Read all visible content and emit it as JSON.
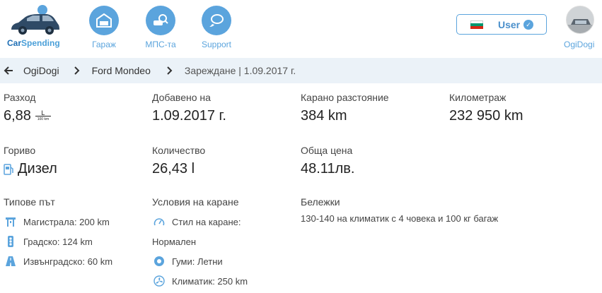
{
  "header": {
    "logo_label_car": "Car",
    "logo_label_spending": "Spending",
    "nav": [
      {
        "label": "Гараж",
        "icon": "garage-icon"
      },
      {
        "label": "МПС-та",
        "icon": "vehicle-search-icon"
      },
      {
        "label": "Support",
        "icon": "support-chat-icon"
      }
    ],
    "user_label": "User",
    "avatar_name": "OgiDogi",
    "accent": "#5ba4dd"
  },
  "breadcrumb": {
    "items": [
      "OgiDogi",
      "Ford Mondeo"
    ],
    "current": "Зареждане | 1.09.2017 г."
  },
  "details": {
    "consumption_label": "Разход",
    "consumption_value": "6,88",
    "consumption_unit_top": "L",
    "consumption_unit_bottom": "100 km",
    "added_label": "Добавено на",
    "added_value": "1.09.2017 г.",
    "distance_label": "Карано разстояние",
    "distance_value": "384 km",
    "odometer_label": "Километраж",
    "odometer_value": "232 950 km",
    "fuel_label": "Гориво",
    "fuel_value": "Дизел",
    "quantity_label": "Количество",
    "quantity_value": "26,43 l",
    "total_label": "Обща цена",
    "total_value": "48.11лв.",
    "road_label": "Типове път",
    "roads": [
      {
        "text": "Магистрала: 200 km",
        "icon": "highway-icon"
      },
      {
        "text": "Градско: 124 km",
        "icon": "traffic-light-icon"
      },
      {
        "text": "Извънградско: 60 km",
        "icon": "road-icon"
      }
    ],
    "conditions_label": "Условия на каране",
    "driving_style_label": "Стил на каране:",
    "driving_style_value": "Нормален",
    "tires_label": "Гуми: Летни",
    "ac_label": "Климатик: 250 km",
    "notes_label": "Бележки",
    "notes_value": "130-140 на климатик с 4 човека и 100 кг багаж"
  }
}
